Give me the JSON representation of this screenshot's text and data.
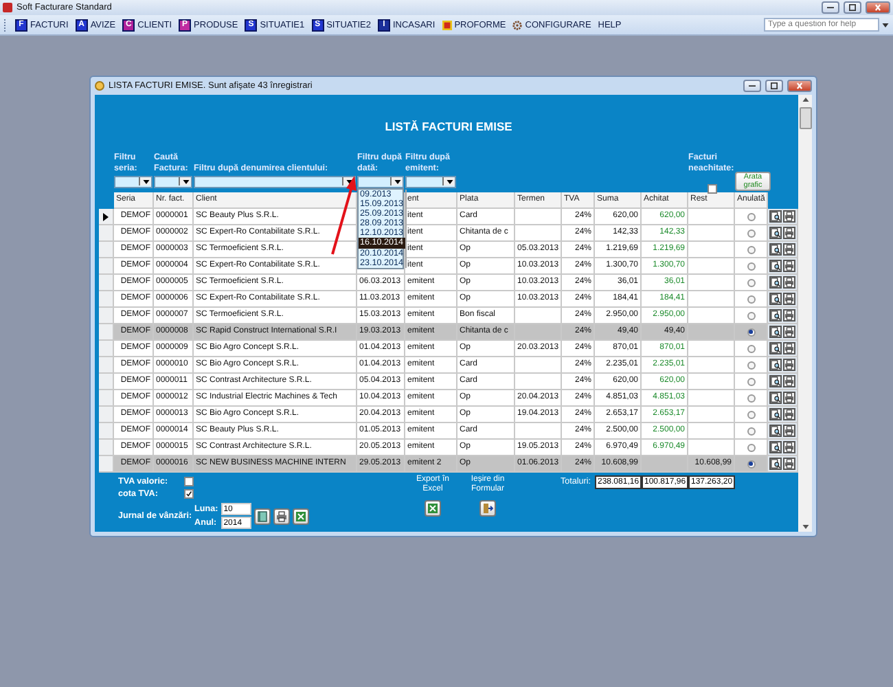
{
  "app": {
    "title": "Soft Facturare Standard"
  },
  "menu": [
    {
      "label": "FACTURI",
      "kind": "letter",
      "letter": "F",
      "color": "#2236d0"
    },
    {
      "label": "AVIZE",
      "kind": "letter",
      "letter": "A",
      "color": "#2236d0"
    },
    {
      "label": "CLIENTI",
      "kind": "letter",
      "letter": "C",
      "color": "#b0209a"
    },
    {
      "label": "PRODUSE",
      "kind": "letter",
      "letter": "P",
      "color": "#c02ca0"
    },
    {
      "label": "SITUATIE1",
      "kind": "letter",
      "letter": "S",
      "color": "#2236d0"
    },
    {
      "label": "SITUATIE2",
      "kind": "letter",
      "letter": "S",
      "color": "#2236d0"
    },
    {
      "label": "INCASARI",
      "kind": "letter",
      "letter": "I",
      "color": "#1b2f9a"
    },
    {
      "label": "PROFORME",
      "kind": "proforme"
    },
    {
      "label": "CONFIGURARE",
      "kind": "gear"
    },
    {
      "label": "HELP",
      "kind": "plain"
    }
  ],
  "help_search": {
    "placeholder": "Type a question for help"
  },
  "window": {
    "title": "LISTA FACTURI EMISE. Sunt afişate 43 înregistrari"
  },
  "heading": "LISTĂ FACTURI EMISE",
  "filters": [
    {
      "label": "Filtru seria:",
      "expanded": false
    },
    {
      "label": "Caută Factura:",
      "expanded": false
    },
    {
      "label": "Filtru după denumirea clientului:",
      "expanded": false
    },
    {
      "label": "Filtru după dată:",
      "expanded": true,
      "items": [
        {
          "label": "09.2013",
          "selected": false
        },
        {
          "label": "15.09.2013",
          "selected": false
        },
        {
          "label": "25.09.2013",
          "selected": false
        },
        {
          "label": "28.09.2013",
          "selected": false
        },
        {
          "label": "12.10.2013",
          "selected": false
        },
        {
          "label": "16.10.2014",
          "selected": true
        },
        {
          "label": "20.10.2014",
          "selected": false
        },
        {
          "label": "23.10.2014",
          "selected": false
        }
      ]
    },
    {
      "label": "Filtru după emitent:",
      "expanded": false
    }
  ],
  "unpaid_filter": {
    "label": "Facturi neachitate:",
    "checked": false
  },
  "chart_button": "Arata grafic",
  "table": {
    "columns": [
      {
        "label": "Seria"
      },
      {
        "label": "Nr. fact."
      },
      {
        "label": "Client"
      },
      {},
      {
        "label": "ent"
      },
      {
        "label": "Plata"
      },
      {
        "label": "Termen"
      },
      {
        "label": "TVA"
      },
      {
        "label": "Suma"
      },
      {
        "label": "Achitat"
      },
      {
        "label": "Rest"
      },
      {
        "label": "Anulată"
      }
    ],
    "rows": [
      {
        "seria": "DEMOF",
        "nr": "0000001",
        "client": "SC Beauty Plus S.R.L.",
        "emitent": "itent",
        "plata": "Card",
        "tva": "24%",
        "suma": "620,00",
        "achitat": "620,00",
        "anulata": false,
        "current": true
      },
      {
        "seria": "DEMOF",
        "nr": "0000002",
        "client": "SC Expert-Ro Contabilitate S.R.L.",
        "emitent": "itent",
        "plata": "Chitanta de c",
        "tva": "24%",
        "suma": "142,33",
        "achitat": "142,33",
        "anulata": false,
        "current": false
      },
      {
        "seria": "DEMOF",
        "nr": "0000003",
        "client": "SC Termoeficient S.R.L.",
        "emitent": "itent",
        "plata": "Op",
        "termen": "05.03.2013",
        "tva": "24%",
        "suma": "1.219,69",
        "achitat": "1.219,69",
        "anulata": false,
        "current": false
      },
      {
        "seria": "DEMOF",
        "nr": "0000004",
        "client": "SC Expert-Ro Contabilitate S.R.L.",
        "emitent": "itent",
        "plata": "Op",
        "termen": "10.03.2013",
        "tva": "24%",
        "suma": "1.300,70",
        "achitat": "1.300,70",
        "anulata": false,
        "current": false
      },
      {
        "seria": "DEMOF",
        "nr": "0000005",
        "client": "SC Termoeficient S.R.L.",
        "data": "06.03.2013",
        "emitent": "emitent",
        "plata": "Op",
        "termen": "10.03.2013",
        "tva": "24%",
        "suma": "36,01",
        "achitat": "36,01",
        "anulata": false,
        "current": false
      },
      {
        "seria": "DEMOF",
        "nr": "0000006",
        "client": "SC Expert-Ro Contabilitate S.R.L.",
        "data": "11.03.2013",
        "emitent": "emitent",
        "plata": "Op",
        "termen": "10.03.2013",
        "tva": "24%",
        "suma": "184,41",
        "achitat": "184,41",
        "anulata": false,
        "current": false
      },
      {
        "seria": "DEMOF",
        "nr": "0000007",
        "client": "SC Termoeficient S.R.L.",
        "data": "15.03.2013",
        "emitent": "emitent",
        "plata": "Bon fiscal",
        "tva": "24%",
        "suma": "2.950,00",
        "achitat": "2.950,00",
        "anulata": false,
        "current": false
      },
      {
        "seria": "DEMOF",
        "nr": "0000008",
        "client": "SC Rapid Construct International S.R.I",
        "data": "19.03.2013",
        "emitent": "emitent",
        "plata": "Chitanta de c",
        "tva": "24%",
        "suma": "49,40",
        "achitat": "49,40",
        "anulata": true,
        "current": false
      },
      {
        "seria": "DEMOF",
        "nr": "0000009",
        "client": "SC Bio Agro Concept S.R.L.",
        "data": "01.04.2013",
        "emitent": "emitent",
        "plata": "Op",
        "termen": "20.03.2013",
        "tva": "24%",
        "suma": "870,01",
        "achitat": "870,01",
        "anulata": false,
        "current": false
      },
      {
        "seria": "DEMOF",
        "nr": "0000010",
        "client": "SC Bio Agro Concept S.R.L.",
        "data": "01.04.2013",
        "emitent": "emitent",
        "plata": "Card",
        "tva": "24%",
        "suma": "2.235,01",
        "achitat": "2.235,01",
        "anulata": false,
        "current": false
      },
      {
        "seria": "DEMOF",
        "nr": "0000011",
        "client": "SC Contrast Architecture S.R.L.",
        "data": "05.04.2013",
        "emitent": "emitent",
        "plata": "Card",
        "tva": "24%",
        "suma": "620,00",
        "achitat": "620,00",
        "anulata": false,
        "current": false
      },
      {
        "seria": "DEMOF",
        "nr": "0000012",
        "client": "SC Industrial Electric Machines & Tech",
        "data": "10.04.2013",
        "emitent": "emitent",
        "plata": "Op",
        "termen": "20.04.2013",
        "tva": "24%",
        "suma": "4.851,03",
        "achitat": "4.851,03",
        "anulata": false,
        "current": false
      },
      {
        "seria": "DEMOF",
        "nr": "0000013",
        "client": "SC Bio Agro Concept S.R.L.",
        "data": "20.04.2013",
        "emitent": "emitent",
        "plata": "Op",
        "termen": "19.04.2013",
        "tva": "24%",
        "suma": "2.653,17",
        "achitat": "2.653,17",
        "anulata": false,
        "current": false
      },
      {
        "seria": "DEMOF",
        "nr": "0000014",
        "client": "SC Beauty Plus S.R.L.",
        "data": "01.05.2013",
        "emitent": "emitent",
        "plata": "Card",
        "tva": "24%",
        "suma": "2.500,00",
        "achitat": "2.500,00",
        "anulata": false,
        "current": false
      },
      {
        "seria": "DEMOF",
        "nr": "0000015",
        "client": "SC Contrast Architecture S.R.L.",
        "data": "20.05.2013",
        "emitent": "emitent",
        "plata": "Op",
        "termen": "19.05.2013",
        "tva": "24%",
        "suma": "6.970,49",
        "achitat": "6.970,49",
        "anulata": false,
        "current": false
      },
      {
        "seria": "DEMOF",
        "nr": "0000016",
        "client": "SC NEW BUSINESS MACHINE INTERN",
        "data": "29.05.2013",
        "emitent": "emitent 2",
        "plata": "Op",
        "termen": "01.06.2013",
        "tva": "24%",
        "suma": "10.608,99",
        "rest": "10.608,99",
        "anulata": true,
        "current": false
      }
    ]
  },
  "footer": {
    "tva_valoric": {
      "label": "TVA valoric:",
      "checked": false
    },
    "cota_tva": {
      "label": "cota TVA:",
      "checked": true
    },
    "jurnal": {
      "label": "Jurnal de vânzări:",
      "luna_label": "Luna:",
      "luna": "10",
      "anul_label": "Anul:",
      "anul": "2014"
    },
    "export_label": "Export în Excel",
    "exit_label": "Ieșire din Formular",
    "totals": {
      "label": "Totaluri:",
      "values": [
        "238.081,16",
        "100.817,96",
        "137.263,20"
      ]
    }
  }
}
